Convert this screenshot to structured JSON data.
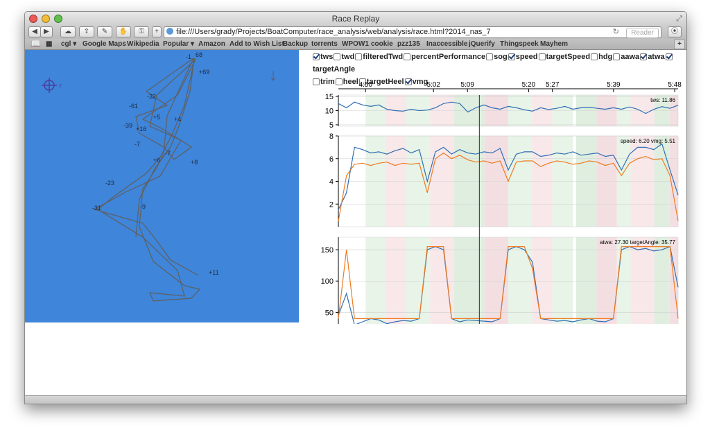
{
  "window": {
    "title": "Race Replay"
  },
  "toolbar": {
    "url": "file:///Users/grady/Projects/BoatComputer/race_analysis/web/analysis/race.html?2014_nas_7",
    "reader": "Reader"
  },
  "bookmarks": [
    "cgl",
    "Google Maps",
    "Wikipedia",
    "Popular",
    "Amazon",
    "Add to Wish List",
    "Backup",
    "torrents",
    "WPOW1",
    "cookie",
    "pzz135",
    "Inaccessible",
    "jQuerify",
    "Thingspeek",
    "Mayhem"
  ],
  "map": {
    "labels": [
      "-1",
      "68",
      "+69",
      "-32",
      "-61",
      "+5",
      "+4",
      "-39",
      "+16",
      "-7",
      "-7",
      "+6",
      "+8",
      "-23",
      "-31",
      "-9",
      "+11"
    ]
  },
  "checkboxes": [
    {
      "label": "tws",
      "checked": true
    },
    {
      "label": "twd",
      "checked": false
    },
    {
      "label": "filteredTwd",
      "checked": false
    },
    {
      "label": "percentPerformance",
      "checked": false
    },
    {
      "label": "sog",
      "checked": false
    },
    {
      "label": "speed",
      "checked": true
    },
    {
      "label": "targetSpeed",
      "checked": false
    },
    {
      "label": "hdg",
      "checked": false
    },
    {
      "label": "aawa",
      "checked": false
    },
    {
      "label": "atwa",
      "checked": true
    },
    {
      "label": "targetAngle",
      "checked": true
    },
    {
      "label": "trim",
      "checked": false
    },
    {
      "label": "heel",
      "checked": false
    },
    {
      "label": "targetHeel",
      "checked": false
    },
    {
      "label": "vmg",
      "checked": true
    }
  ],
  "chart_data": {
    "type": "line",
    "time_ticks": [
      "4:50",
      "5:02",
      "5:09",
      "5:20",
      "5:27",
      "5:39",
      "5:48"
    ],
    "colors": {
      "blue": "#2f6db3",
      "orange": "#f07a1f"
    },
    "panels": [
      {
        "readout": "tws: 11.86",
        "ylim": [
          4.5,
          15.5
        ],
        "ticks": [
          "15",
          "10",
          "5"
        ],
        "series": [
          {
            "color": "#2f6db3",
            "values": [
              12.5,
              11,
              13,
              12,
              11.5,
              12,
              10.5,
              10,
              9.8,
              10.5,
              10,
              10.2,
              11,
              12.5,
              13,
              12.5,
              9.5,
              11,
              12,
              11,
              10.5,
              11.5,
              11,
              10.3,
              9.8,
              11,
              10.4,
              10.8,
              11.5,
              10.5,
              11,
              11.2,
              10.8,
              10.5,
              11,
              10.5,
              11.3,
              10.5,
              9,
              10.5,
              11.4,
              10.8,
              11.9
            ]
          }
        ]
      },
      {
        "readout": "speed: 6.20 vmg: 5.51",
        "ylim": [
          0,
          8
        ],
        "ticks": [
          "8",
          "6",
          "4",
          "2"
        ],
        "series": [
          {
            "color": "#2f6db3",
            "values": [
              1.5,
              3,
              7,
              6.8,
              6.5,
              6.6,
              6.4,
              6.7,
              6.9,
              6.5,
              6.8,
              4,
              6.6,
              7,
              6.4,
              6.8,
              6.5,
              6.4,
              6.6,
              6.5,
              6.9,
              5,
              6.4,
              6.6,
              6.6,
              6.2,
              6.3,
              6.5,
              6.4,
              6.6,
              6.3,
              6.4,
              6.5,
              6.2,
              6.3,
              5,
              6.4,
              7,
              7,
              6.8,
              7.3,
              5,
              2.8
            ]
          },
          {
            "color": "#f07a1f",
            "values": [
              0.5,
              4.5,
              5.5,
              5.6,
              5.4,
              5.6,
              5.7,
              5.4,
              5.6,
              5.5,
              5.6,
              3,
              6,
              6.5,
              6,
              6.3,
              5.9,
              5.7,
              5.8,
              5.6,
              5.8,
              4,
              5.7,
              5.8,
              5.8,
              5.3,
              5.6,
              5.8,
              5.7,
              5.5,
              5.6,
              5.8,
              5.7,
              5.4,
              5.6,
              4.5,
              5.6,
              6,
              6.2,
              5.9,
              6,
              4.5,
              0.5
            ]
          }
        ]
      },
      {
        "readout": "atwa: 27.30 targetAngle: 35.77",
        "ylim": [
          25,
          170
        ],
        "ticks": [
          "50",
          "100",
          "150"
        ],
        "series": [
          {
            "color": "#2f6db3",
            "values": [
              45,
              80,
              30,
              35,
              40,
              38,
              32,
              35,
              37,
              36,
              40,
              150,
              155,
              150,
              40,
              35,
              38,
              37,
              36,
              35,
              40,
              150,
              155,
              150,
              130,
              40,
              38,
              36,
              37,
              35,
              38,
              40,
              36,
              35,
              40,
              150,
              155,
              150,
              152,
              148,
              150,
              155,
              90
            ]
          },
          {
            "color": "#f07a1f",
            "values": [
              40,
              150,
              40,
              40,
              40,
              40,
              40,
              40,
              40,
              40,
              40,
              155,
              155,
              155,
              40,
              40,
              40,
              40,
              40,
              40,
              40,
              155,
              155,
              155,
              120,
              40,
              40,
              40,
              40,
              40,
              40,
              40,
              40,
              40,
              40,
              155,
              155,
              155,
              155,
              155,
              155,
              155,
              40
            ]
          }
        ]
      }
    ]
  }
}
